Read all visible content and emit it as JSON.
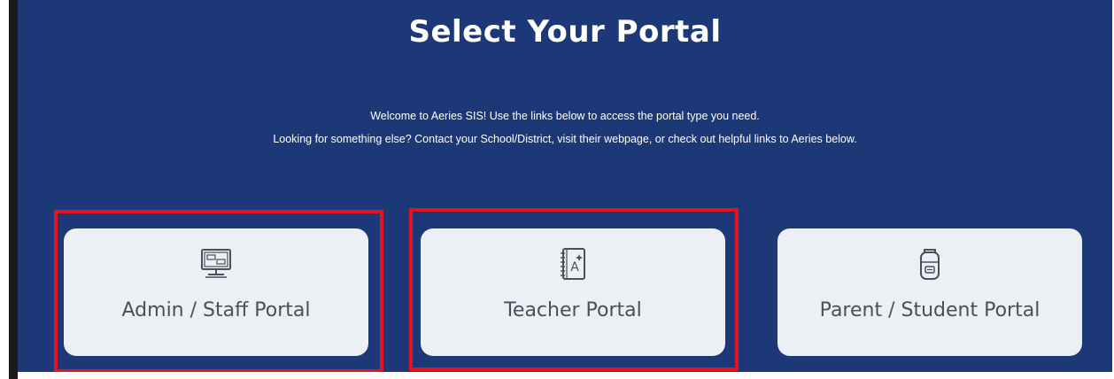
{
  "page": {
    "title": "Select Your Portal",
    "welcome_line1": "Welcome to Aeries SIS! Use the links below to access the portal type you need.",
    "welcome_line2": "Looking for something else? Contact your School/District, visit their webpage, or check out helpful links to Aeries below."
  },
  "portals": [
    {
      "label": "Admin / Staff Portal",
      "icon": "computer-monitor-icon",
      "highlighted": true
    },
    {
      "label": "Teacher Portal",
      "icon": "notebook-icon",
      "highlighted": true
    },
    {
      "label": "Parent / Student Portal",
      "icon": "backpack-icon",
      "highlighted": false
    }
  ],
  "colors": {
    "background": "#1c3877",
    "card": "#eceff4",
    "card_text": "#4a4f5a",
    "highlight": "#e3141b"
  }
}
